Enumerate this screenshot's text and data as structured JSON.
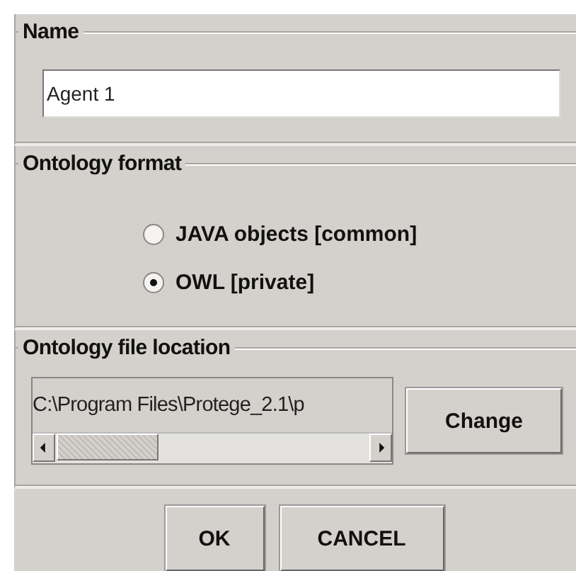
{
  "name_section": {
    "title": "Name",
    "field": {
      "value": "Agent 1"
    }
  },
  "format_section": {
    "title": "Ontology format",
    "options": [
      {
        "label": "JAVA objects [common]",
        "selected": false
      },
      {
        "label": "OWL [private]",
        "selected": true
      }
    ]
  },
  "location_section": {
    "title": "Ontology file location",
    "path": "C:\\Program Files\\Protege_2.1\\p",
    "button": "Change"
  },
  "buttons": [
    "OK",
    "CANCEL"
  ]
}
